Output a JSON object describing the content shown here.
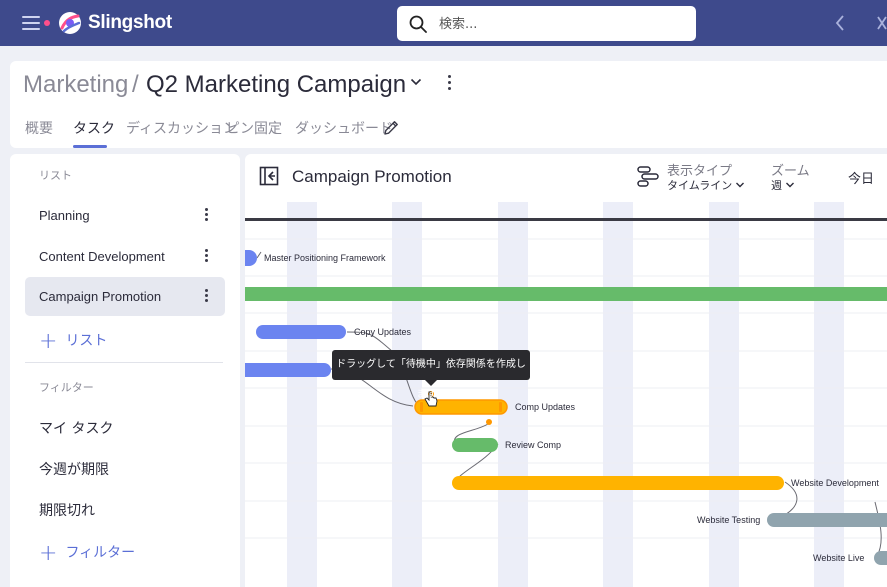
{
  "app": {
    "name": "Slingshot",
    "search_placeholder": "検索..."
  },
  "header": {
    "breadcrumb_parent": "Marketing",
    "breadcrumb_sep": "/",
    "title": "Q2 Marketing Campaign",
    "tabs": [
      {
        "label": "概要",
        "active": false
      },
      {
        "label": "タスク",
        "active": true
      },
      {
        "label": "ディスカッション",
        "active": false
      },
      {
        "label": "ピン固定",
        "active": false
      },
      {
        "label": "ダッシュボード",
        "active": false
      }
    ]
  },
  "sidebar": {
    "lists_label": "リスト",
    "lists": [
      {
        "label": "Planning",
        "selected": false
      },
      {
        "label": "Content Development",
        "selected": false
      },
      {
        "label": "Campaign Promotion",
        "selected": true
      }
    ],
    "add_list_label": "リスト",
    "filters_label": "フィルター",
    "filters": [
      {
        "label": "マイ タスク"
      },
      {
        "label": "今週が期限"
      },
      {
        "label": "期限切れ"
      }
    ],
    "add_filter_label": "フィルター"
  },
  "main": {
    "list_title": "Campaign Promotion",
    "view_type_label": "表示タイプ",
    "view_type_value": "タイムライン",
    "zoom_label": "ズーム",
    "zoom_value": "週",
    "today_label": "今日",
    "tooltip": "ドラッグして「待機中」依存関係を作成します。"
  },
  "colors": {
    "topbar": "#3e4a8c",
    "accent": "#5b6fd6",
    "bar_blue": "#6b84f0",
    "bar_green": "#66bb6a",
    "bar_yellow": "#ffb300",
    "bar_gray": "#90a4ae",
    "weekend_stripe": "#eceef8"
  },
  "tasks": [
    {
      "name": "Master Positioning Framework",
      "color": "blue"
    },
    {
      "name": "",
      "color": "green",
      "summary": true
    },
    {
      "name": "Copy Updates",
      "color": "blue"
    },
    {
      "name": "",
      "color": "blue"
    },
    {
      "name": "Comp Updates",
      "color": "yellow",
      "state": "dragging"
    },
    {
      "name": "Review Comp",
      "color": "green"
    },
    {
      "name": "Website Development",
      "color": "yellow"
    },
    {
      "name": "Website Testing",
      "color": "gray"
    },
    {
      "name": "Website Live",
      "color": "gray"
    }
  ]
}
